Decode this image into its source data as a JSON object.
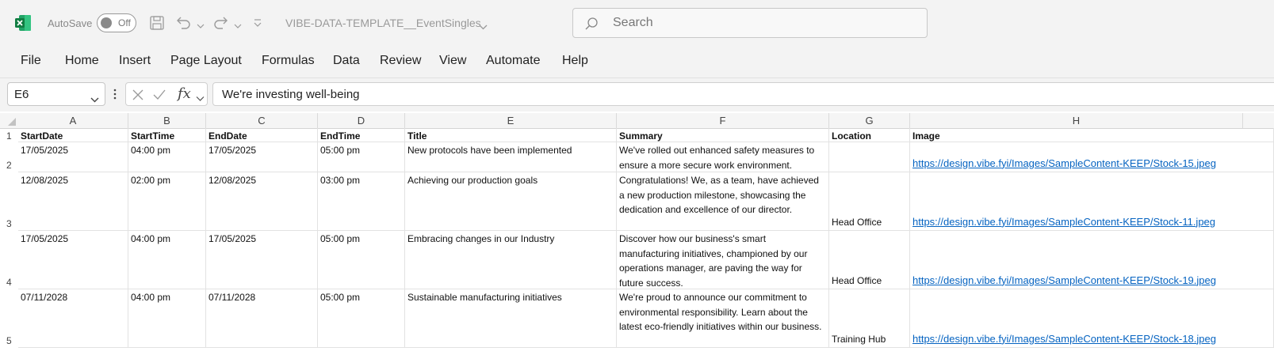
{
  "titlebar": {
    "autosave_label": "AutoSave",
    "autosave_state": "Off",
    "document_title": "VIBE-DATA-TEMPLATE__EventSingles",
    "search_placeholder": "Search"
  },
  "ribbon": {
    "tabs": [
      "File",
      "Home",
      "Insert",
      "Page Layout",
      "Formulas",
      "Data",
      "Review",
      "View",
      "Automate",
      "Help"
    ]
  },
  "formula_bar": {
    "cell_ref": "E6",
    "fx": "fx",
    "formula": "We're investing well-being"
  },
  "sheet": {
    "columns": [
      "A",
      "B",
      "C",
      "D",
      "E",
      "F",
      "G",
      "H"
    ],
    "row_numbers": [
      "1",
      "2",
      "3",
      "4",
      "5"
    ],
    "header": [
      "StartDate",
      "StartTime",
      "EndDate",
      "EndTime",
      "Title",
      "Summary",
      "Location",
      "Image"
    ],
    "rows": [
      {
        "start_date": "17/05/2025",
        "start_time": "04:00 pm",
        "end_date": "17/05/2025",
        "end_time": "05:00 pm",
        "title": "New protocols have been implemented",
        "summary": "We've rolled out enhanced safety measures to ensure a more secure work environment.",
        "location": "",
        "image": "https://design.vibe.fyi/Images/SampleContent-KEEP/Stock-15.jpeg"
      },
      {
        "start_date": "12/08/2025",
        "start_time": "02:00 pm",
        "end_date": "12/08/2025",
        "end_time": "03:00 pm",
        "title": "Achieving our production goals",
        "summary": "Congratulations! We, as a team, have achieved a new production milestone, showcasing the dedication and excellence of our director.",
        "location": "Head Office",
        "image": "https://design.vibe.fyi/Images/SampleContent-KEEP/Stock-11.jpeg"
      },
      {
        "start_date": "17/05/2025",
        "start_time": "04:00 pm",
        "end_date": "17/05/2025",
        "end_time": "05:00 pm",
        "title": "Embracing changes in our Industry",
        "summary": "Discover how our business's smart manufacturing initiatives, championed by our operations manager, are paving the way for future success.",
        "location": "Head Office",
        "image": "https://design.vibe.fyi/Images/SampleContent-KEEP/Stock-19.jpeg"
      },
      {
        "start_date": "07/11/2028",
        "start_time": "04:00 pm",
        "end_date": "07/11/2028",
        "end_time": "05:00 pm",
        "title": "Sustainable manufacturing initiatives",
        "summary": "We're proud to announce our commitment to environmental responsibility. Learn about the latest eco-friendly initiatives within our business.",
        "location": "Training Hub",
        "image": "https://design.vibe.fyi/Images/SampleContent-KEEP/Stock-18.jpeg"
      }
    ]
  },
  "icons": [
    "excel-logo-icon",
    "save-icon",
    "undo-icon",
    "redo-icon",
    "customize-qat-icon",
    "search-icon",
    "cancel-icon",
    "enter-icon",
    "fx-icon"
  ],
  "colors": {
    "excel_green": "#107c41",
    "link": "#0563c1"
  }
}
